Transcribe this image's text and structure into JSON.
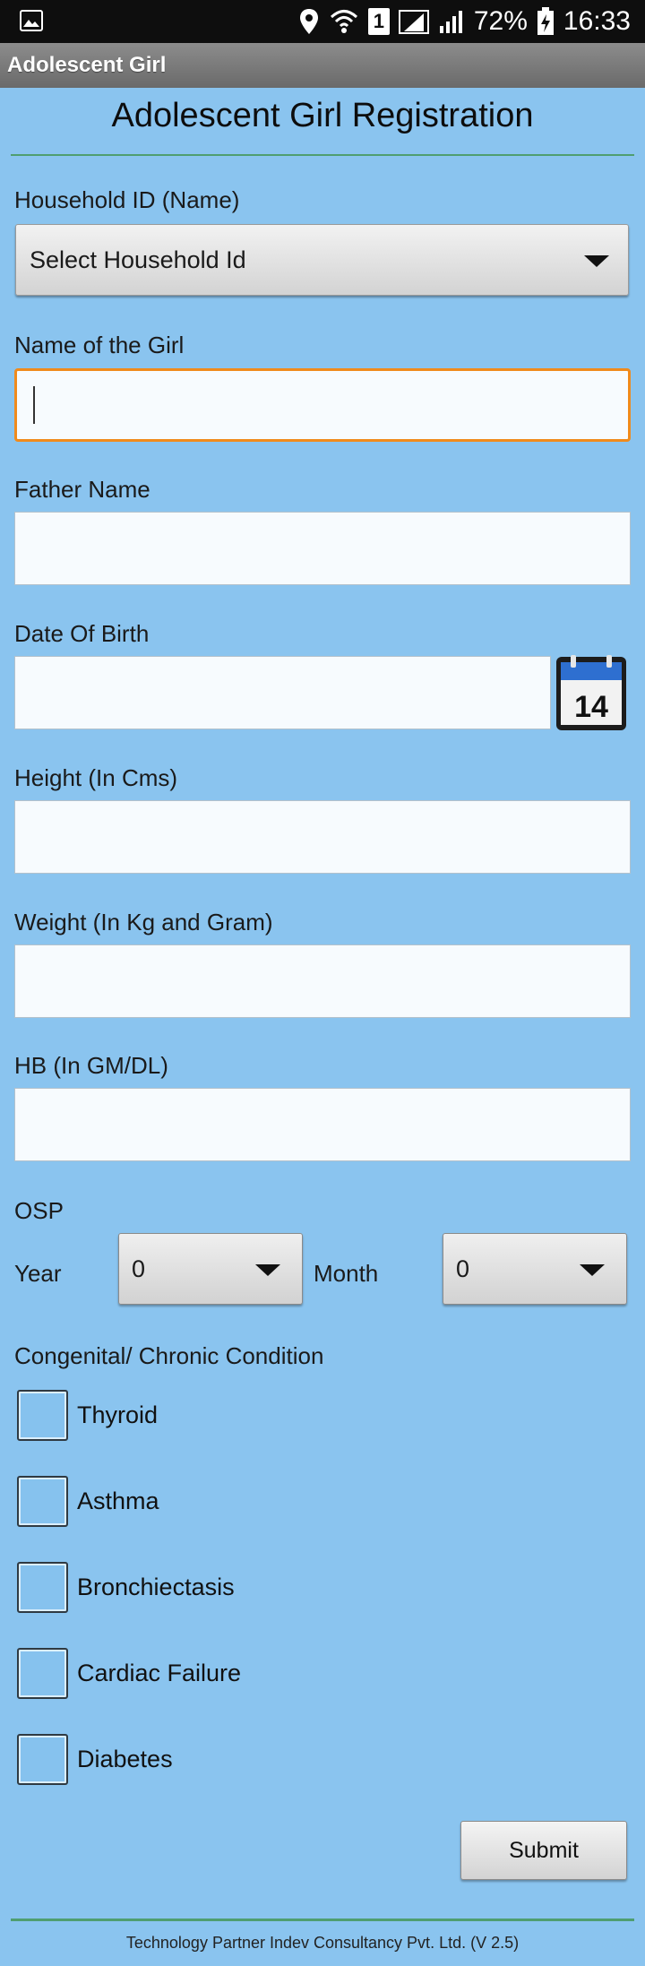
{
  "status_bar": {
    "battery": "72%",
    "time": "16:33",
    "sim_number": "1"
  },
  "app_bar": {
    "title": "Adolescent Girl"
  },
  "form": {
    "title": "Adolescent Girl Registration",
    "household": {
      "label": "Household ID (Name)",
      "selected": "Select Household Id"
    },
    "girl_name": {
      "label": "Name of the Girl",
      "value": ""
    },
    "father_name": {
      "label": "Father Name",
      "value": ""
    },
    "dob": {
      "label": "Date Of Birth",
      "value": "",
      "calendar_day": "14"
    },
    "height": {
      "label": "Height (In Cms)",
      "value": ""
    },
    "weight": {
      "label": "Weight (In Kg and Gram)",
      "value": ""
    },
    "hb": {
      "label": "HB (In GM/DL)",
      "value": ""
    },
    "osp": {
      "label": "OSP",
      "year_label": "Year",
      "year_value": "0",
      "month_label": "Month",
      "month_value": "0"
    },
    "conditions": {
      "label": "Congenital/ Chronic Condition",
      "items": [
        {
          "label": "Thyroid",
          "checked": false
        },
        {
          "label": "Asthma",
          "checked": false
        },
        {
          "label": "Bronchiectasis",
          "checked": false
        },
        {
          "label": "Cardiac Failure",
          "checked": false
        },
        {
          "label": "Diabetes",
          "checked": false
        }
      ]
    },
    "submit_label": "Submit"
  },
  "footer": {
    "text": "Technology Partner Indev Consultancy Pvt. Ltd. (V 2.5)"
  },
  "colors": {
    "background": "#8ac4ef",
    "focus_border": "#f08a1c",
    "divider": "#4f9e70",
    "calendar_header": "#2e6fd0"
  }
}
